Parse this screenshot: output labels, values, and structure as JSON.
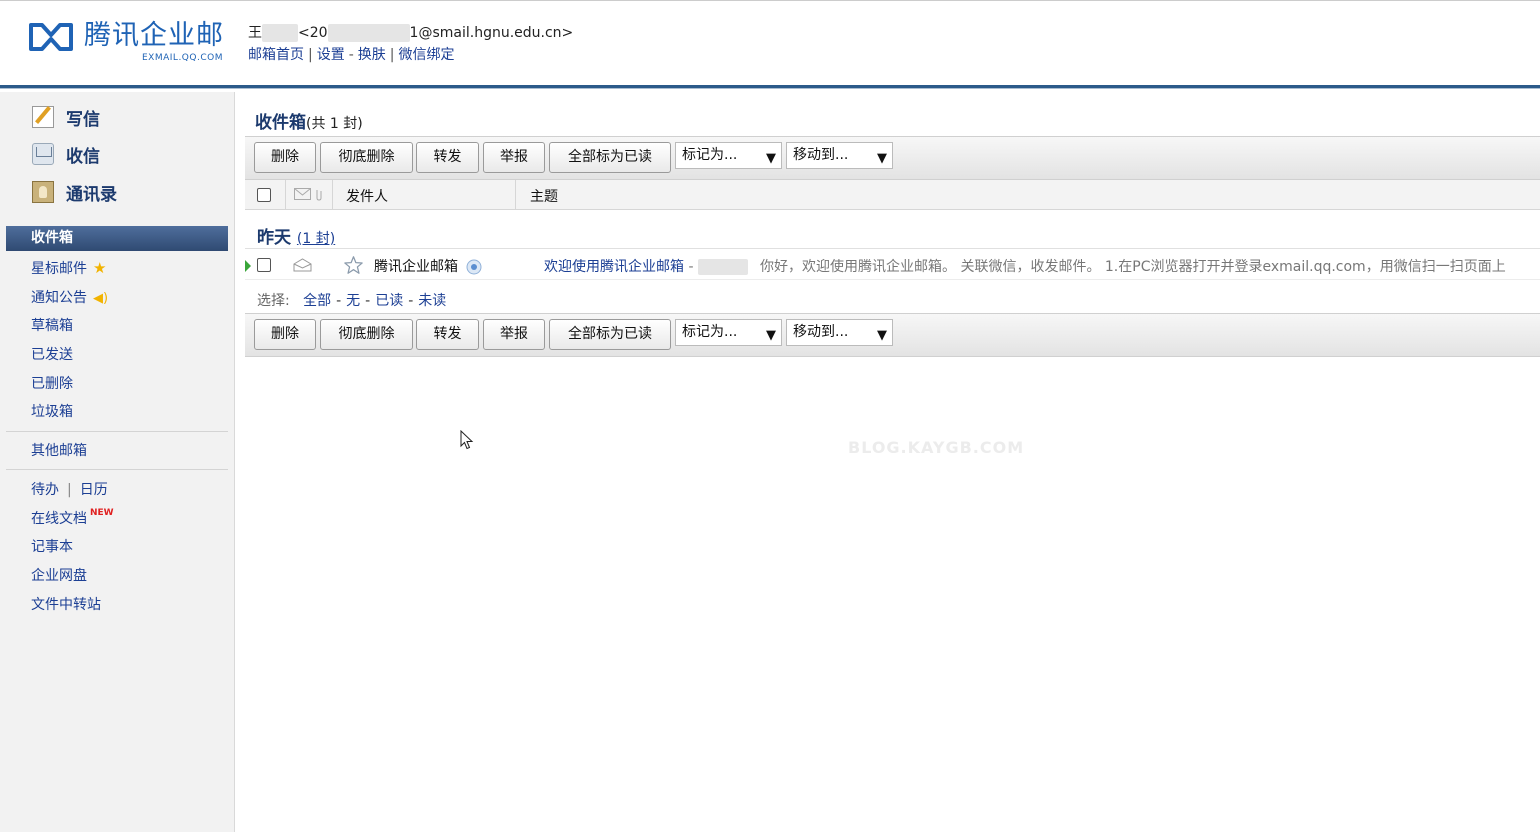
{
  "header": {
    "logo_text": "腾讯企业邮",
    "logo_sub": "EXMAIL.QQ.COM",
    "user_name_prefix": "王",
    "user_email_start": "<20",
    "user_email_end": "1@smail.hgnu.edu.cn>",
    "links": [
      "邮箱首页",
      "设置",
      "换肤",
      "微信绑定"
    ]
  },
  "sidebar": {
    "write": "写信",
    "receive": "收信",
    "contacts": "通讯录",
    "folders": [
      "收件箱",
      "星标邮件",
      "通知公告",
      "草稿箱",
      "已发送",
      "已删除",
      "垃圾箱"
    ],
    "other": "其他邮箱",
    "todo": "待办",
    "calendar": "日历",
    "online_docs": "在线文档",
    "new_tag": "NEW",
    "notes": "记事本",
    "netdisk": "企业网盘",
    "transfer": "文件中转站"
  },
  "main": {
    "title": "收件箱",
    "count": "(共 1 封)",
    "toolbar": {
      "delete": "删除",
      "perm_delete": "彻底删除",
      "forward": "转发",
      "report": "举报",
      "mark_all_read": "全部标为已读",
      "mark_as": "标记为...",
      "move_to": "移动到..."
    },
    "columns": {
      "sender": "发件人",
      "subject": "主题"
    },
    "group": {
      "title": "昨天",
      "count": "(1 封)"
    },
    "mails": [
      {
        "sender": "腾讯企业邮箱",
        "subject": "欢迎使用腾讯企业邮箱",
        "subject_sep": " - ",
        "preview": "你好，欢迎使用腾讯企业邮箱。 关联微信，收发邮件。 1.在PC浏览器打开并登录exmail.qq.com，用微信扫一扫页面上"
      }
    ],
    "select": {
      "label": "选择:",
      "all": "全部",
      "none": "无",
      "read": "已读",
      "unread": "未读"
    }
  },
  "watermark": "BLOG.KAYGB.COM"
}
